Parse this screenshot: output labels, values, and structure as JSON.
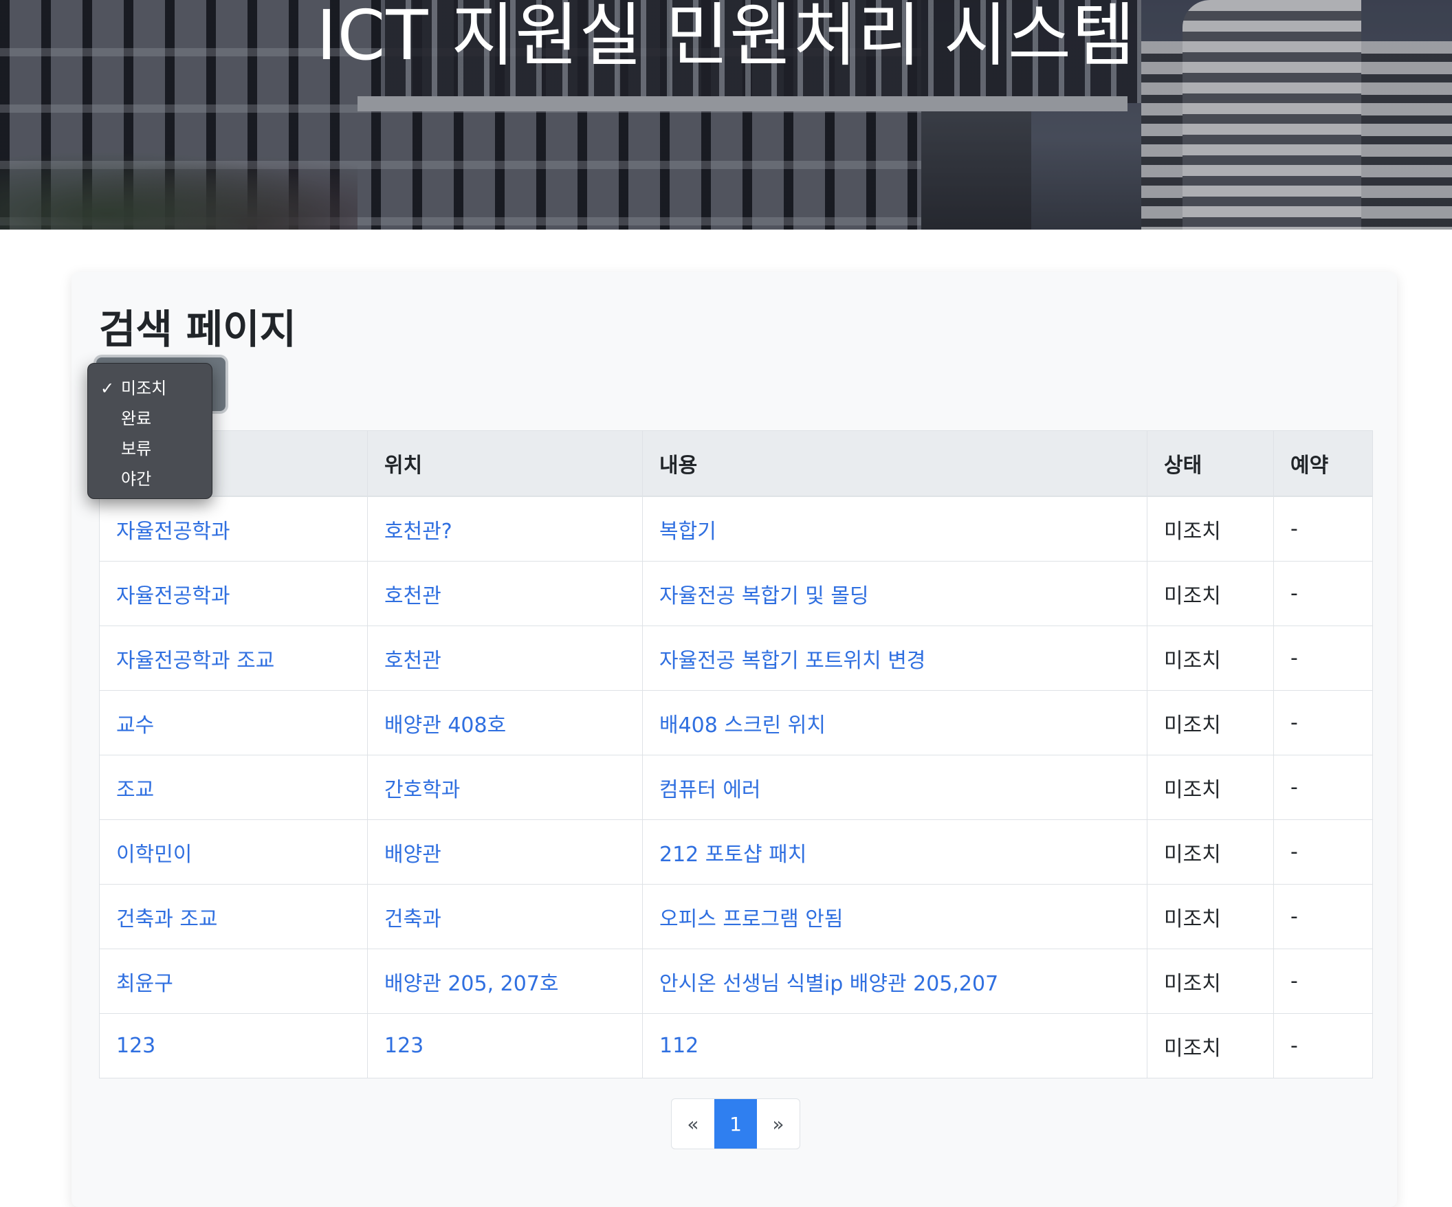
{
  "header": {
    "title": "ICT 지원실 민원처리 시스템"
  },
  "main": {
    "heading": "검색 페이지",
    "status_filter": {
      "options": [
        "미조치",
        "완료",
        "보류",
        "야간"
      ],
      "selected": "미조치"
    },
    "table": {
      "columns": [
        "위치",
        "내용",
        "상태",
        "예약"
      ],
      "rows": [
        [
          "자율전공학과",
          "호천관?",
          "복합기",
          "미조치",
          "-"
        ],
        [
          "자율전공학과",
          "호천관",
          "자율전공 복합기 및 몰딩",
          "미조치",
          "-"
        ],
        [
          "자율전공학과 조교",
          "호천관",
          "자율전공 복합기 포트위치 변경",
          "미조치",
          "-"
        ],
        [
          "교수",
          "배양관 408호",
          "배408 스크린 위치",
          "미조치",
          "-"
        ],
        [
          "조교",
          "간호학과",
          "컴퓨터 에러",
          "미조치",
          "-"
        ],
        [
          "이학민이",
          "배양관",
          "212 포토샵 패치",
          "미조치",
          "-"
        ],
        [
          "건축과 조교",
          "건축과",
          "오피스 프로그램 안됨",
          "미조치",
          "-"
        ],
        [
          "최윤구",
          "배양관 205, 207호",
          "안시온 선생님 식별ip 배양관 205,207",
          "미조치",
          "-"
        ],
        [
          "123",
          "123",
          "112",
          "미조치",
          "-"
        ]
      ]
    },
    "pagination": {
      "prev": "«",
      "current": "1",
      "next": "»"
    }
  },
  "colors": {
    "link": "#2f6fe0",
    "active_page": "#2f7ff0",
    "header_bg": "#e9ecef"
  },
  "icons": {
    "selected_option": "checkmark-icon"
  }
}
